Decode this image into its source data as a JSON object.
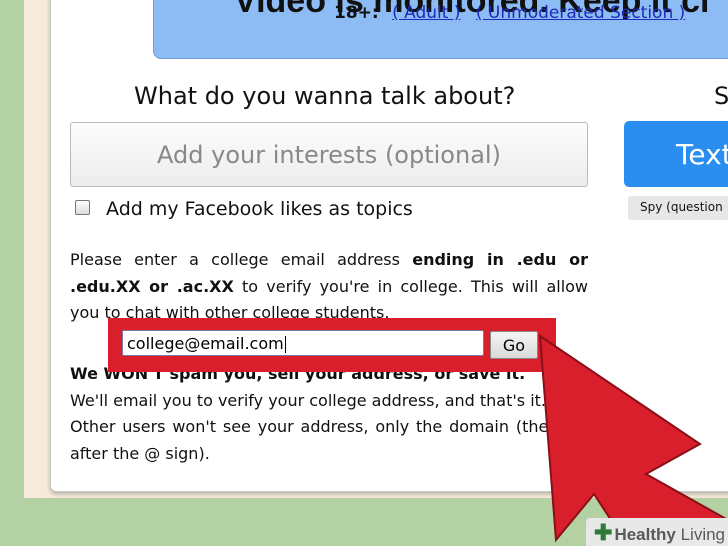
{
  "banner": {
    "title": "Video is monitored. Keep it cl",
    "age_label": "18+:",
    "links": [
      "( Adult )",
      "( Unmoderated Section )"
    ]
  },
  "topics": {
    "question": "What do you wanna talk about?",
    "interests_placeholder": "Add your interests (optional)",
    "facebook_label": "Add my Facebook likes as topics"
  },
  "side": {
    "heading_letter": "S",
    "text_button": "Text",
    "spy_label": "Spy (question"
  },
  "college": {
    "intro_plain": "Please enter a college email address ",
    "intro_bold": "ending in .edu or .edu.XX or .ac.XX",
    "intro_rest": " to verify you're in college. This will allow you to chat with other college students.",
    "email_value": "college@email.com",
    "go_label": "Go",
    "no_spam": "We WON'T spam you, sell your address, or save it.",
    "verify_line": "We'll email you to verify your college address, and that's it.",
    "domain_line": "Other users won't see your address, only the domain (the part after the @ sign)."
  },
  "watermark": {
    "brand_1": "Healthy",
    "brand_2": "Living"
  },
  "colors": {
    "highlight_red": "#d91e2c",
    "button_blue": "#2a8ef0",
    "banner_blue": "#8dbcf4"
  }
}
